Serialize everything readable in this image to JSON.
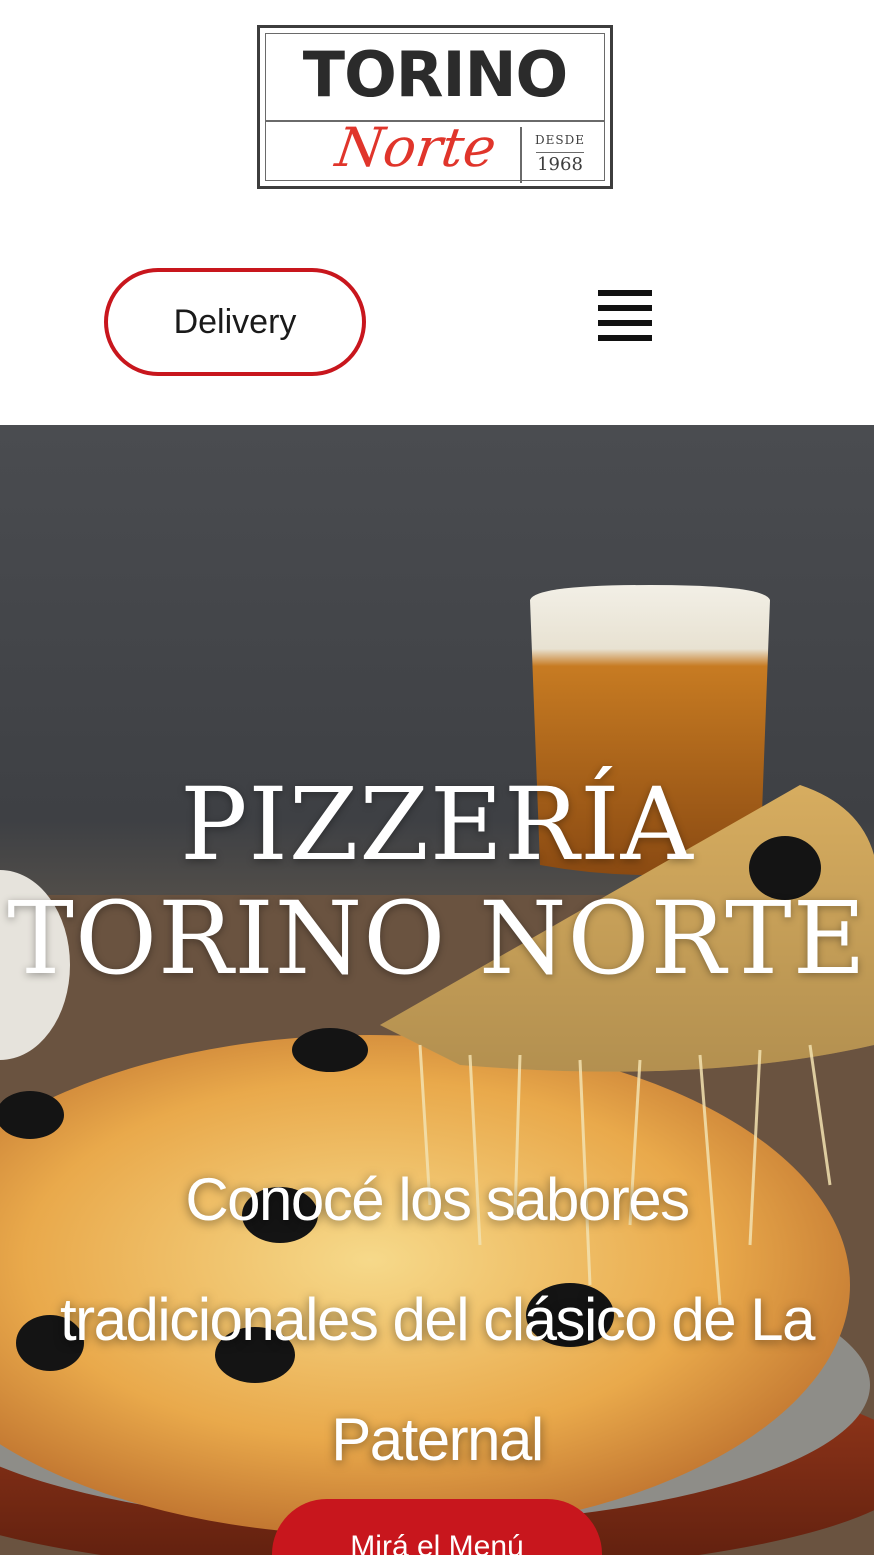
{
  "brand": {
    "logo_name": "TORINO",
    "logo_script": "Norte",
    "logo_since": "DESDE",
    "logo_year": "1968"
  },
  "header": {
    "delivery_label": "Delivery",
    "menu_icon": "hamburger-menu-icon"
  },
  "hero": {
    "title": "PIZZERÍA TORINO NORTE",
    "subtitle": "Conocé los sabores tradicionales del clásico de La Paternal",
    "cta_label": "Mirá el Menú"
  },
  "colors": {
    "accent_red": "#c8161d",
    "logo_red": "#e0352b",
    "logo_dark": "#2b2b2b"
  }
}
